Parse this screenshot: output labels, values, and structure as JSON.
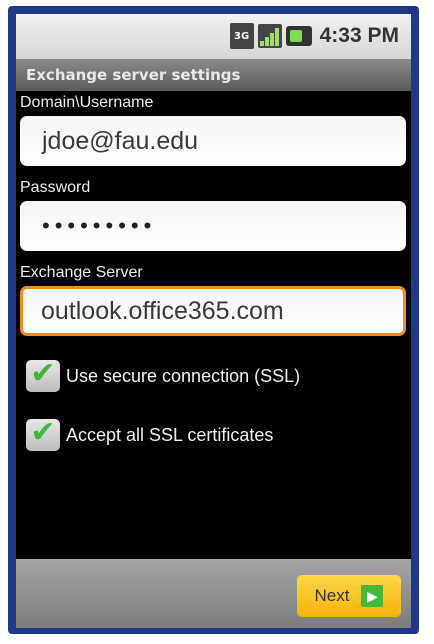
{
  "status_bar": {
    "network_label": "3G",
    "time": "4:33 PM"
  },
  "title": "Exchange server settings",
  "fields": {
    "domain_label": "Domain\\Username",
    "domain_value": "jdoe@fau.edu",
    "password_label": "Password",
    "password_value": "•••••••••",
    "server_label": "Exchange Server",
    "server_value": "outlook.office365.com"
  },
  "options": {
    "ssl_label": "Use secure connection (SSL)",
    "ssl_checked": true,
    "accept_certs_label": "Accept all SSL certificates",
    "accept_certs_checked": true
  },
  "bottom_bar": {
    "next_label": "Next"
  },
  "colors": {
    "focus_border": "#f08a24",
    "check_green": "#3fb83a",
    "next_button": "#f2b20b"
  }
}
